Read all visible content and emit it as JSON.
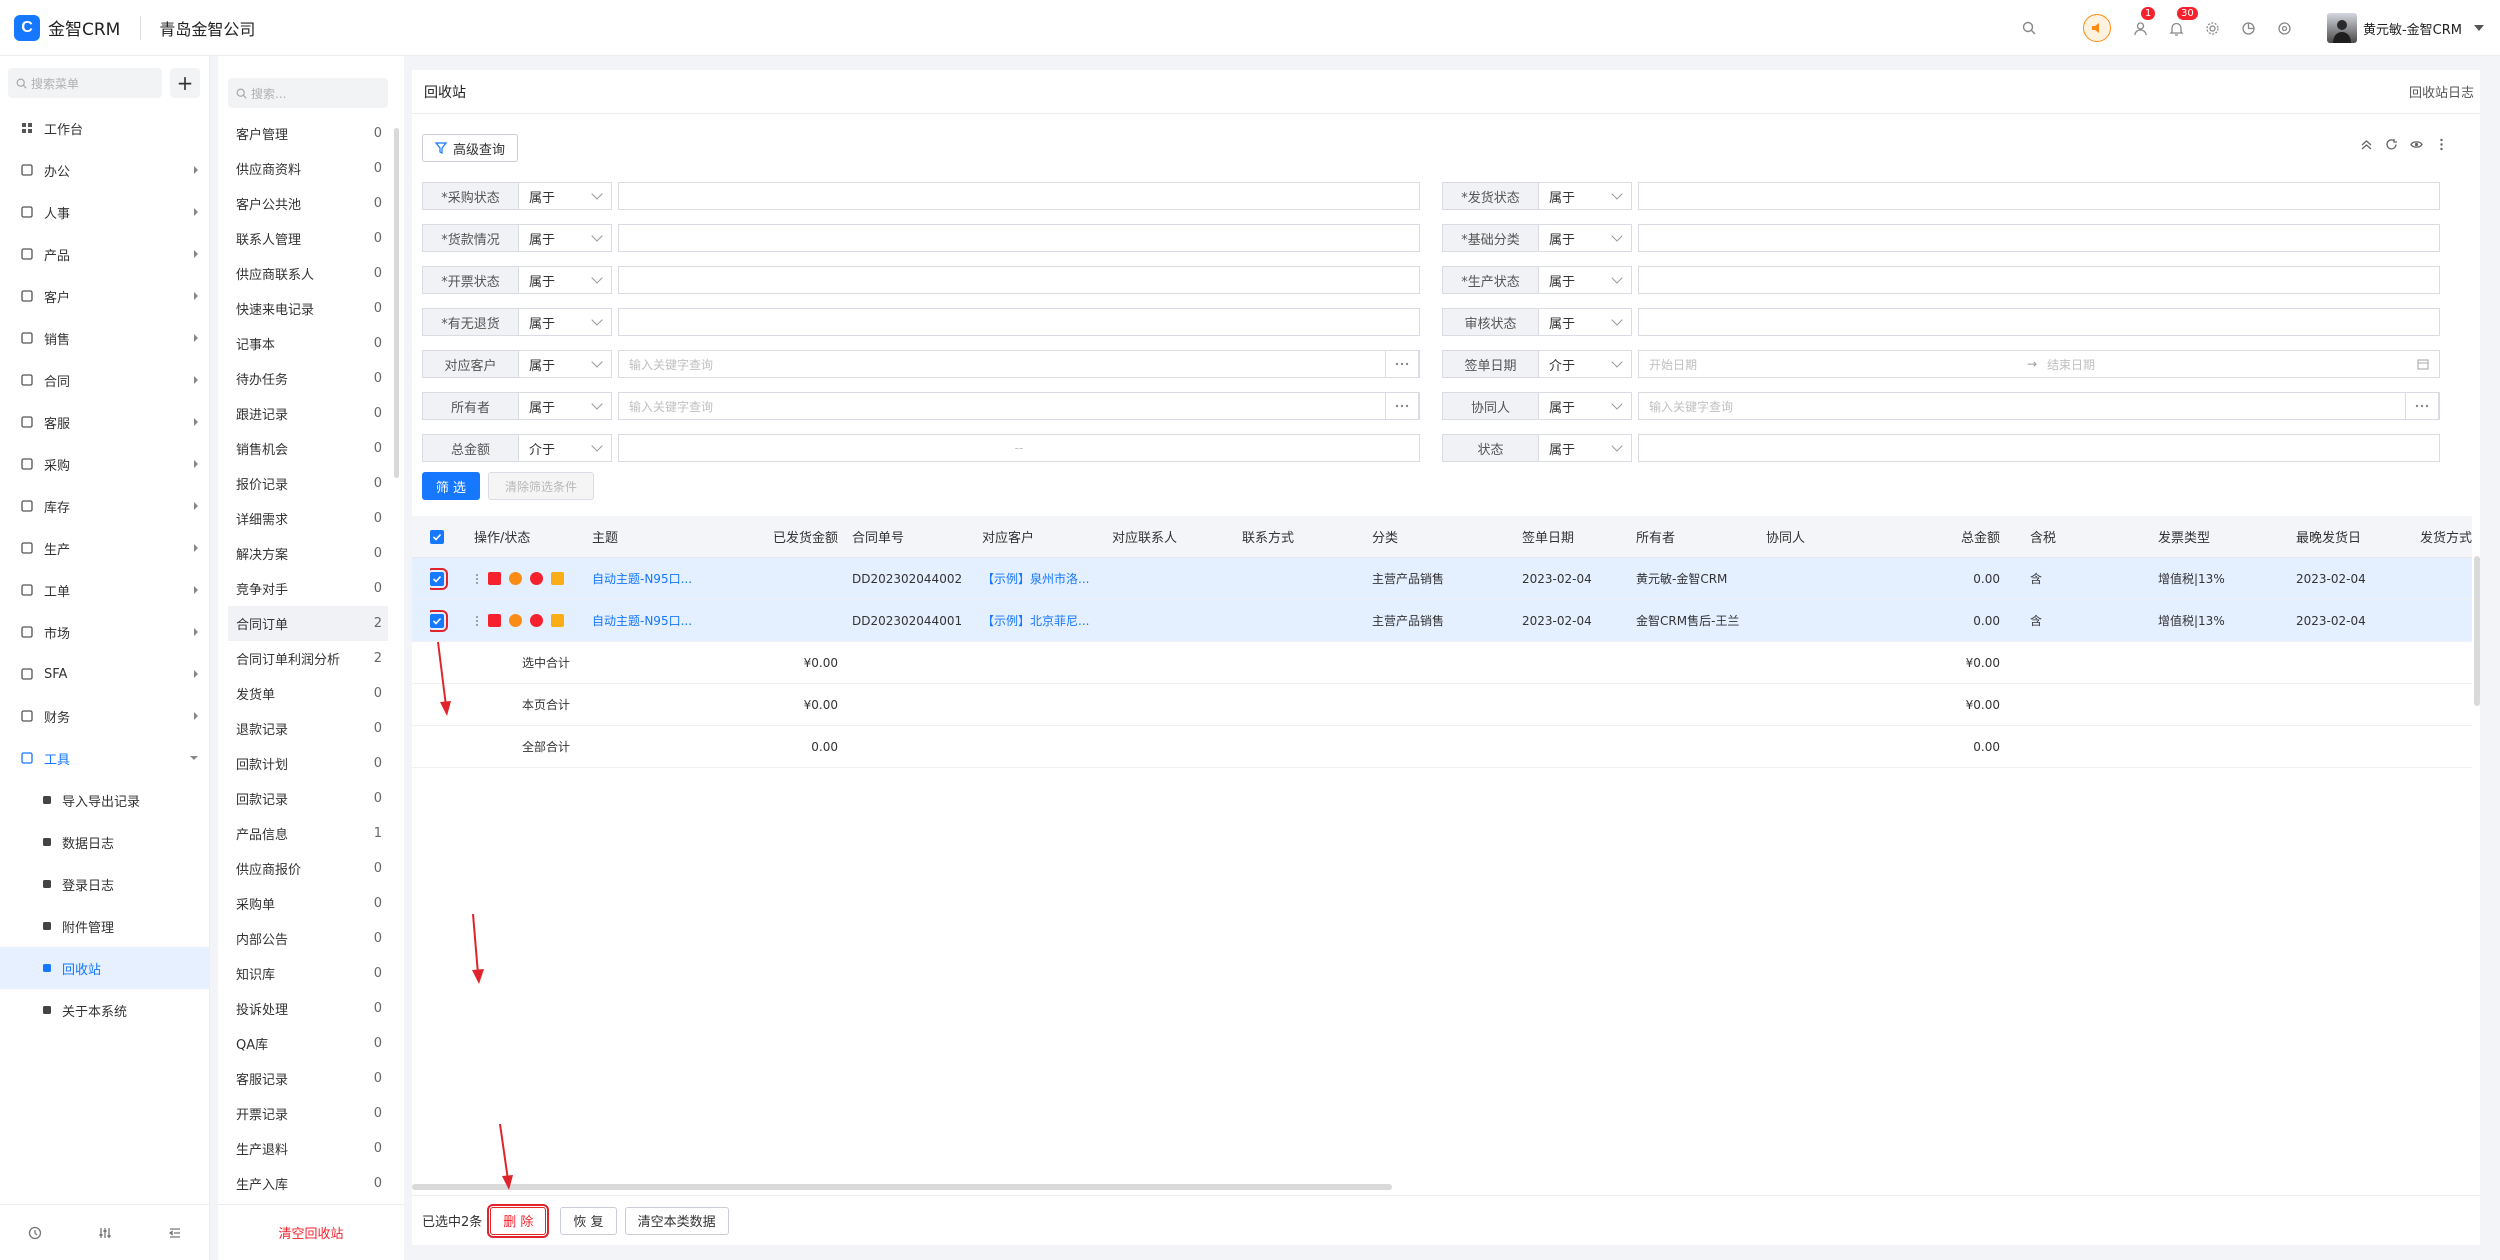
{
  "app": {
    "logo_mark": "C",
    "name": "金智CRM",
    "company": "青岛金智公司"
  },
  "topbar": {
    "icons": [
      "search-icon",
      "speaker-icon",
      "user-msg-icon",
      "bell-icon",
      "gear-icon",
      "chart-icon",
      "help-icon"
    ],
    "msg_badge": "1",
    "bell_badge": "30",
    "user_name": "黄元敏-金智CRM"
  },
  "sidebar": {
    "search_placeholder": "搜索菜单",
    "add": "+",
    "items": [
      {
        "label": "工作台",
        "icon": "dashboard-icon"
      },
      {
        "label": "办公",
        "icon": "office-icon"
      },
      {
        "label": "人事",
        "icon": "people-icon"
      },
      {
        "label": "产品",
        "icon": "product-icon"
      },
      {
        "label": "客户",
        "icon": "customer-icon"
      },
      {
        "label": "销售",
        "icon": "sales-icon"
      },
      {
        "label": "合同",
        "icon": "contract-icon"
      },
      {
        "label": "客服",
        "icon": "service-icon"
      },
      {
        "label": "采购",
        "icon": "purchase-icon"
      },
      {
        "label": "库存",
        "icon": "inventory-icon"
      },
      {
        "label": "生产",
        "icon": "production-icon"
      },
      {
        "label": "工单",
        "icon": "ticket-icon"
      },
      {
        "label": "市场",
        "icon": "market-icon"
      },
      {
        "label": "SFA",
        "icon": "sfa-icon"
      },
      {
        "label": "财务",
        "icon": "finance-icon"
      },
      {
        "label": "工具",
        "icon": "tools-icon"
      }
    ],
    "sub_items": [
      {
        "label": "导入导出记录"
      },
      {
        "label": "数据日志"
      },
      {
        "label": "登录日志"
      },
      {
        "label": "附件管理"
      },
      {
        "label": "回收站"
      },
      {
        "label": "关于本系统"
      }
    ]
  },
  "categories": {
    "search_placeholder": "搜索...",
    "items": [
      {
        "label": "客户管理",
        "count": "0"
      },
      {
        "label": "供应商资料",
        "count": "0"
      },
      {
        "label": "客户公共池",
        "count": "0"
      },
      {
        "label": "联系人管理",
        "count": "0"
      },
      {
        "label": "供应商联系人",
        "count": "0"
      },
      {
        "label": "快速来电记录",
        "count": "0"
      },
      {
        "label": "记事本",
        "count": "0"
      },
      {
        "label": "待办任务",
        "count": "0"
      },
      {
        "label": "跟进记录",
        "count": "0"
      },
      {
        "label": "销售机会",
        "count": "0"
      },
      {
        "label": "报价记录",
        "count": "0"
      },
      {
        "label": "详细需求",
        "count": "0"
      },
      {
        "label": "解决方案",
        "count": "0"
      },
      {
        "label": "竞争对手",
        "count": "0"
      },
      {
        "label": "合同订单",
        "count": "2"
      },
      {
        "label": "合同订单利润分析",
        "count": "2"
      },
      {
        "label": "发货单",
        "count": "0"
      },
      {
        "label": "退款记录",
        "count": "0"
      },
      {
        "label": "回款计划",
        "count": "0"
      },
      {
        "label": "回款记录",
        "count": "0"
      },
      {
        "label": "产品信息",
        "count": "1"
      },
      {
        "label": "供应商报价",
        "count": "0"
      },
      {
        "label": "采购单",
        "count": "0"
      },
      {
        "label": "内部公告",
        "count": "0"
      },
      {
        "label": "知识库",
        "count": "0"
      },
      {
        "label": "投诉处理",
        "count": "0"
      },
      {
        "label": "QA库",
        "count": "0"
      },
      {
        "label": "客服记录",
        "count": "0"
      },
      {
        "label": "开票记录",
        "count": "0"
      },
      {
        "label": "生产退料",
        "count": "0"
      },
      {
        "label": "生产入库",
        "count": "0"
      }
    ],
    "clear_label": "清空回收站"
  },
  "main": {
    "title": "回收站",
    "log_link": "回收站日志",
    "adv_query": "高级查询",
    "filters_left": [
      {
        "label": "*采购状态",
        "op": "属于",
        "placeholder": ""
      },
      {
        "label": "*货款情况",
        "op": "属于",
        "placeholder": ""
      },
      {
        "label": "*开票状态",
        "op": "属于",
        "placeholder": ""
      },
      {
        "label": "*有无退货",
        "op": "属于",
        "placeholder": ""
      },
      {
        "label": "对应客户",
        "op": "属于",
        "placeholder": "输入关键字查询"
      },
      {
        "label": "所有者",
        "op": "属于",
        "placeholder": "输入关键字查询"
      },
      {
        "label": "总金额",
        "op": "介于",
        "placeholder": "--"
      }
    ],
    "filters_right": [
      {
        "label": "*发货状态",
        "op": "属于",
        "placeholder": ""
      },
      {
        "label": "*基础分类",
        "op": "属于",
        "placeholder": ""
      },
      {
        "label": "*生产状态",
        "op": "属于",
        "placeholder": ""
      },
      {
        "label": "审核状态",
        "op": "属于",
        "placeholder": ""
      },
      {
        "label": "签单日期",
        "op": "介于",
        "placeholder": "开始日期",
        "placeholder2": "结束日期",
        "sep": "→"
      },
      {
        "label": "协同人",
        "op": "属于",
        "placeholder": "输入关键字查询"
      },
      {
        "label": "状态",
        "op": "属于",
        "placeholder": ""
      }
    ],
    "filter_btn": "筛 选",
    "clear_filter_btn": "清除筛选条件",
    "columns": [
      "操作/状态",
      "主题",
      "已发货金额",
      "合同单号",
      "对应客户",
      "对应联系人",
      "联系方式",
      "分类",
      "签单日期",
      "所有者",
      "协同人",
      "总金额",
      "含税",
      "发票类型",
      "最晚发货日",
      "发货方式"
    ],
    "rows": [
      {
        "subject": "自动主题-N95口...",
        "shipped": "",
        "contract_no": "DD202302044002",
        "customer": "【示例】泉州市洛...",
        "contact": "",
        "phone": "",
        "category": "主营产品销售",
        "sign_date": "2023-02-04",
        "owner": "黄元敏-金智CRM",
        "co": "",
        "total": "0.00",
        "tax": "含",
        "invoice": "增值税|13%",
        "latest_ship": "2023-02-04",
        "ship_method": ""
      },
      {
        "subject": "自动主题-N95口...",
        "shipped": "",
        "contract_no": "DD202302044001",
        "customer": "【示例】北京菲尼...",
        "contact": "",
        "phone": "",
        "category": "主营产品销售",
        "sign_date": "2023-02-04",
        "owner": "金智CRM售后-王兰",
        "co": "",
        "total": "0.00",
        "tax": "含",
        "invoice": "增值税|13%",
        "latest_ship": "2023-02-04",
        "ship_method": ""
      }
    ],
    "summary": [
      {
        "label": "选中合计",
        "shipped": "¥0.00",
        "total": "¥0.00"
      },
      {
        "label": "本页合计",
        "shipped": "¥0.00",
        "total": "¥0.00"
      },
      {
        "label": "全部合计",
        "shipped": "0.00",
        "total": "0.00"
      }
    ],
    "selected_text": "已选中2条",
    "delete_btn": "删 除",
    "restore_btn": "恢 复",
    "clear_type_btn": "清空本类数据"
  },
  "colors": {
    "accent": "#1677ff",
    "danger": "#f5222d",
    "selected_row": "#e4efff"
  }
}
